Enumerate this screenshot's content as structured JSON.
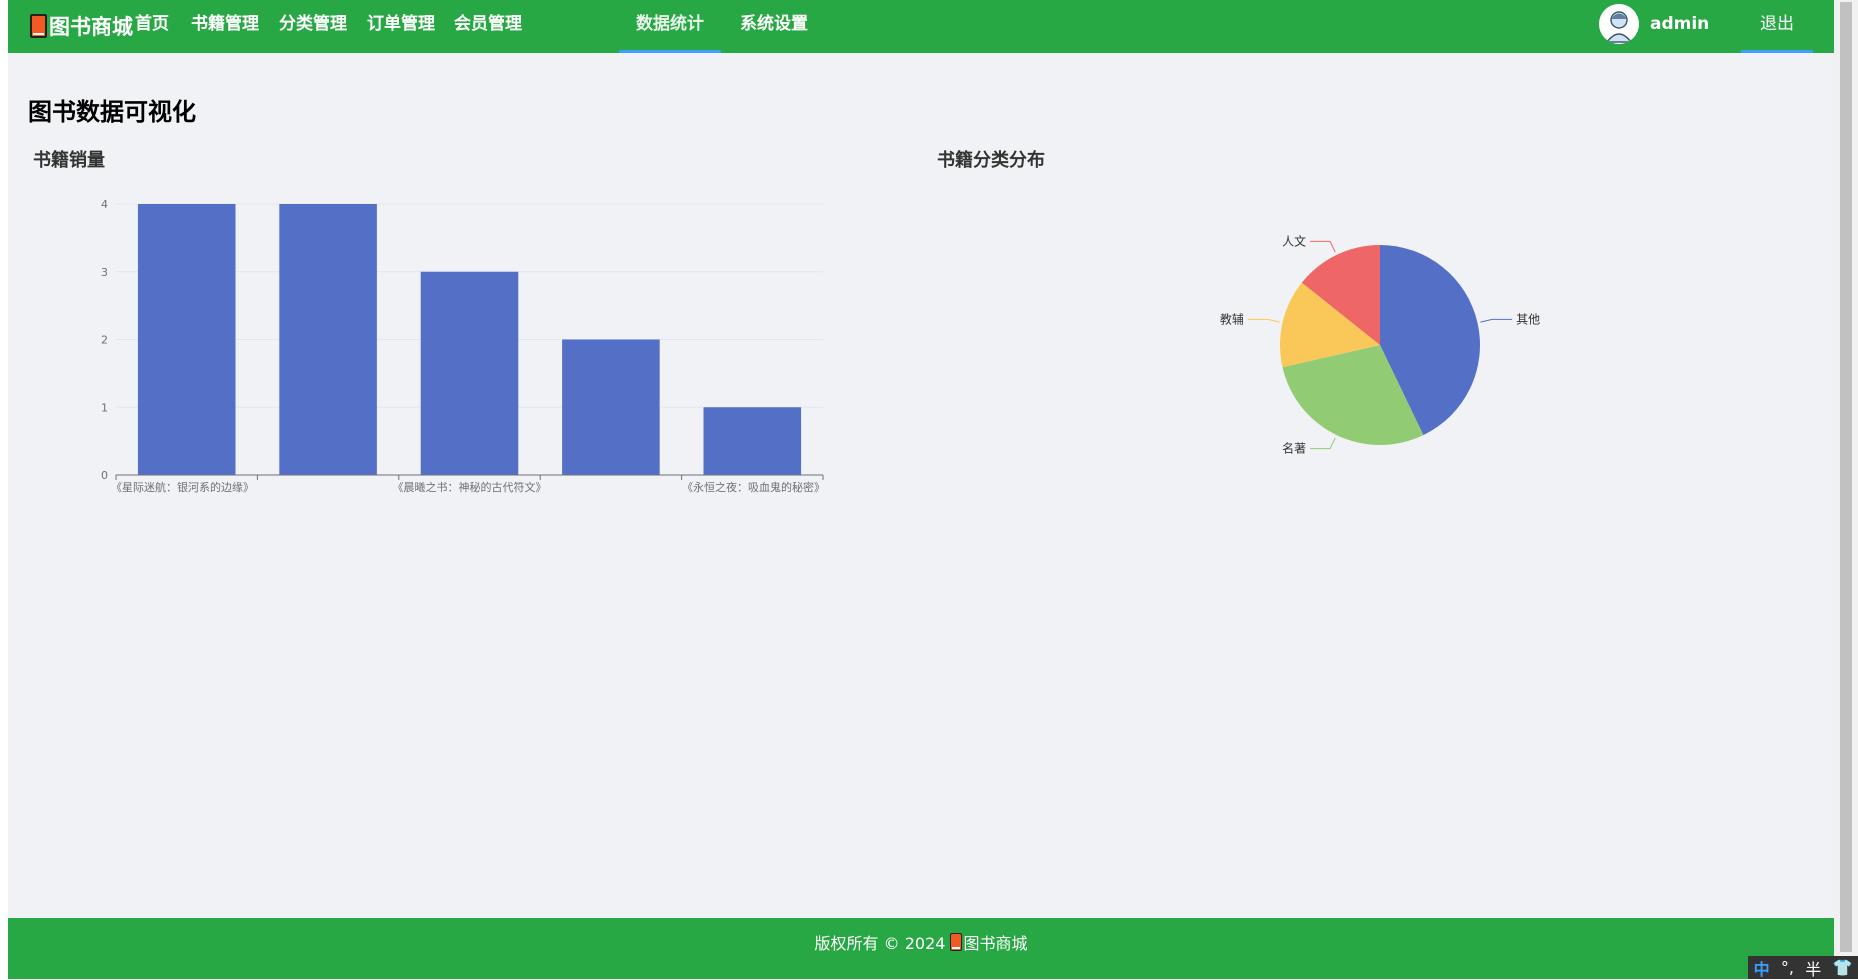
{
  "navbar": {
    "brand": "图书商城",
    "items": [
      {
        "label": "首页"
      },
      {
        "label": "书籍管理"
      },
      {
        "label": "分类管理"
      },
      {
        "label": "订单管理"
      },
      {
        "label": "会员管理"
      },
      {
        "label": "数据统计",
        "active": true
      },
      {
        "label": "系统设置"
      }
    ],
    "username": "admin",
    "logout_label": "退出"
  },
  "page": {
    "title": "图书数据可视化"
  },
  "colors": {
    "navbar": "#28a745",
    "background": "#f0f2f5",
    "bar": "#5470c6",
    "pie": [
      "#5470c6",
      "#91cc75",
      "#fac858",
      "#ee6666"
    ]
  },
  "chart_data": [
    {
      "type": "bar",
      "title": "书籍销量",
      "categories": [
        "《星际迷航：银河系的边缘》",
        "",
        "《晨曦之书：神秘的古代符文》",
        "",
        "《永恒之夜：吸血鬼的秘密》"
      ],
      "values": [
        4,
        4,
        3,
        2,
        1
      ],
      "ylim": [
        0,
        4
      ],
      "yticks": [
        0,
        1,
        2,
        3,
        4
      ],
      "grid": true
    },
    {
      "type": "pie",
      "title": "书籍分类分布",
      "labels": [
        "其他",
        "名著",
        "教辅",
        "人文"
      ],
      "values": [
        6,
        4,
        2,
        2
      ]
    }
  ],
  "footer": {
    "text_before": "版权所有 © 2024",
    "brand": "图书商城"
  },
  "ime": {
    "mode": "中",
    "punct": "°,",
    "width": "半"
  }
}
